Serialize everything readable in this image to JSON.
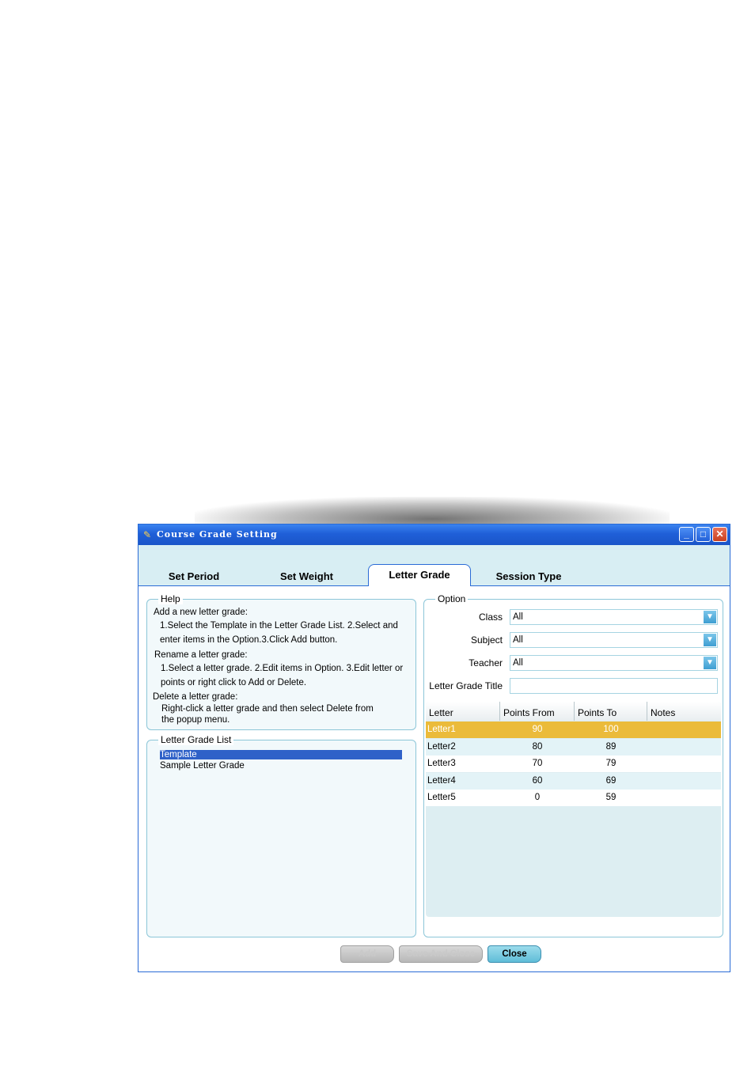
{
  "window": {
    "title": "Course Grade Setting",
    "controls": {
      "minimize": "_",
      "maximize": "□",
      "close": "✕"
    }
  },
  "tabs": [
    {
      "label": "Set Period",
      "active": false
    },
    {
      "label": "Set Weight",
      "active": false
    },
    {
      "label": "Letter Grade",
      "active": true
    },
    {
      "label": "Session Type",
      "active": false
    }
  ],
  "help": {
    "legend": "Help",
    "lines": [
      "Add a new letter grade:",
      "1.Select the Template in the Letter Grade List. 2.Select and",
      "enter items in the Option.3.Click Add button.",
      "Rename a letter grade:",
      "1.Select a letter grade. 2.Edit items in Option. 3.Edit letter or",
      "points or right click to Add or Delete.",
      "Delete a letter grade:",
      "Right-click a letter grade and then select Delete from",
      "the popup menu."
    ]
  },
  "letter_grade_list": {
    "legend": "Letter Grade List",
    "items": [
      {
        "label": "Template",
        "selected": true
      },
      {
        "label": "Sample Letter Grade",
        "selected": false
      }
    ]
  },
  "option": {
    "legend": "Option",
    "class": {
      "label": "Class",
      "value": "All"
    },
    "subject": {
      "label": "Subject",
      "value": "All"
    },
    "teacher": {
      "label": "Teacher",
      "value": "All"
    },
    "title": {
      "label": "Letter Grade Title",
      "value": ""
    }
  },
  "grade_table": {
    "columns": [
      "Letter",
      "Points From",
      "Points To",
      "Notes"
    ],
    "rows": [
      {
        "letter": "Letter1",
        "from": "90",
        "to": "100",
        "notes": ""
      },
      {
        "letter": "Letter2",
        "from": "80",
        "to": "89",
        "notes": ""
      },
      {
        "letter": "Letter3",
        "from": "70",
        "to": "79",
        "notes": ""
      },
      {
        "letter": "Letter4",
        "from": "60",
        "to": "69",
        "notes": ""
      },
      {
        "letter": "Letter5",
        "from": "0",
        "to": "59",
        "notes": ""
      }
    ],
    "selected_row": 0
  },
  "buttons": {
    "add": "Add",
    "save_close": "Save And Close",
    "close": "Close"
  },
  "colors": {
    "title_bar": "#1f5fd8",
    "tab_strip": "#d8eef3",
    "selected_row": "#ebbb3a",
    "list_selection": "#2f61c8"
  }
}
